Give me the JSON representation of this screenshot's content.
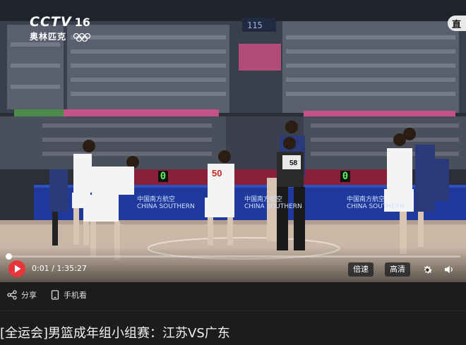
{
  "channel": {
    "logo_text": "CCTV",
    "number": "16",
    "subtitle": "奥林匹克"
  },
  "live_tag": "直",
  "broadcast": {
    "score_left": "0",
    "score_right": "0",
    "ad_brand_cn": "中国南方航空",
    "ad_brand_en": "CHINA SOUTHERN",
    "jersey_player": "50",
    "jersey_referee": "58",
    "jumbotron_number": "115"
  },
  "player": {
    "current_time": "0:01",
    "separator": "/",
    "duration": "1:35:27",
    "progress": 0.001,
    "speed_label": "倍速",
    "quality_label": "高清"
  },
  "actions": {
    "share_label": "分享",
    "mobile_label": "手机看"
  },
  "video_title": "[全运会]男篮成年组小组赛：江苏VS广东",
  "colors": {
    "accent": "#e5363a",
    "bar_bg": "#1c1c1e",
    "title_text": "#f2f2f2"
  },
  "icons": [
    "play-icon",
    "share-icon",
    "mobile-icon",
    "settings-gear-icon",
    "volume-icon",
    "olympic-rings-icon"
  ]
}
